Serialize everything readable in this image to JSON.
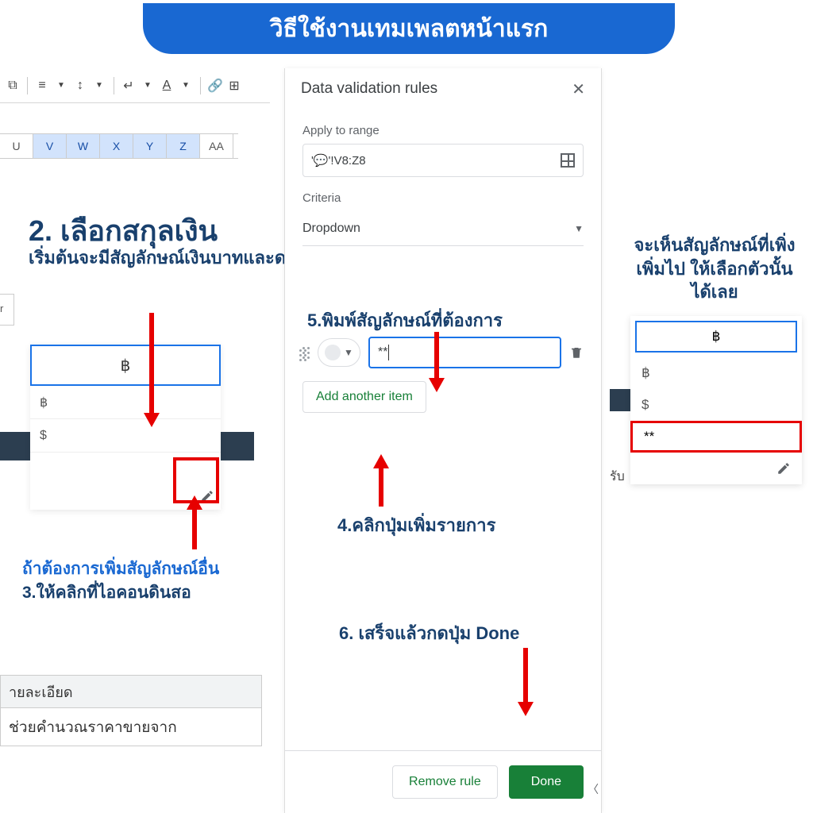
{
  "banner": "วิธีใช้งานเทมเพลตหน้าแรก",
  "columns": [
    "U",
    "V",
    "W",
    "X",
    "Y",
    "Z",
    "AA"
  ],
  "step2": {
    "title": "2. เลือกสกุลเงิน",
    "sub": "เริ่มต้นจะมีสัญลักษณ์เงินบาทและดอลล่า"
  },
  "fragment_er": "r",
  "dropdown_cell": {
    "selected": "฿",
    "opts": [
      "฿",
      "$"
    ]
  },
  "ann3a": "ถ้าต้องการเพิ่มสัญลักษณ์อื่น",
  "ann3b": "3.ให้คลิกที่ไอคอนดินสอ",
  "panel": {
    "title": "Data validation rules",
    "apply_label": "Apply to range",
    "range": "'💬'!V8:Z8",
    "criteria_label": "Criteria",
    "criteria_value": "Dropdown",
    "item_value": "**",
    "add_item": "Add another item",
    "remove": "Remove rule",
    "done": "Done"
  },
  "step5": "5.พิมพ์สัญลักษณ์ที่ต้องการ",
  "step4": "4.คลิกปุ่มเพิ่มรายการ",
  "step6": "6. เสร็จแล้วกดปุ่ม Done",
  "right_ann": "จะเห็นสัญลักษณ์ที่เพิ่งเพิ่มไป ให้เลือกตัวนั้นได้เลย",
  "right_dd": {
    "selected": "฿",
    "opts": [
      "฿",
      "$",
      "**"
    ]
  },
  "right_label": "รับ",
  "bottom": {
    "head": "ายละเอียด",
    "cell": "ช่วยคำนวณราคาขายจาก"
  }
}
